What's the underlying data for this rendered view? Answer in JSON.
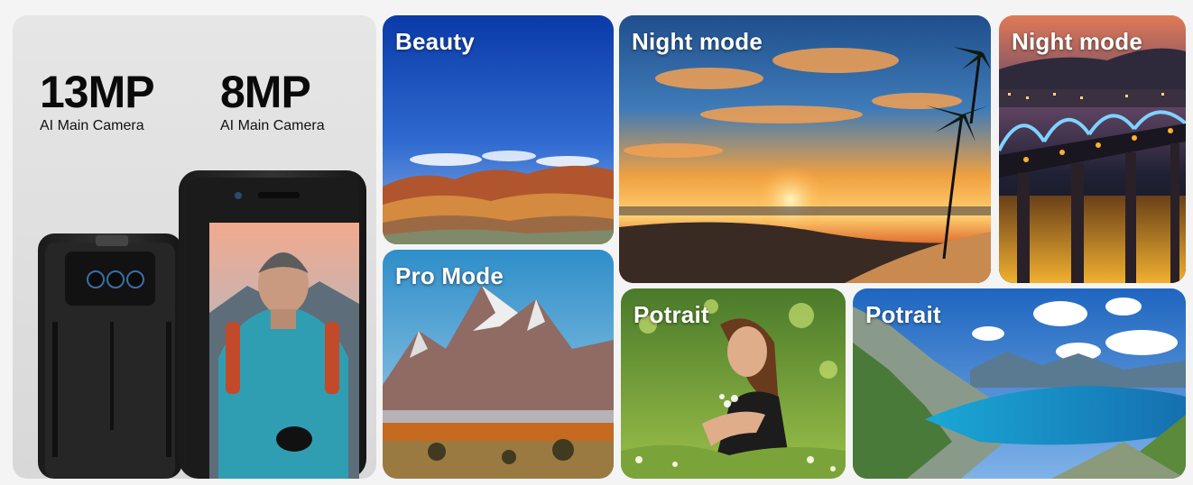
{
  "hero": {
    "specs": [
      {
        "value": "13MP",
        "caption": "AI Main Camera"
      },
      {
        "value": "8MP",
        "caption": "AI Main Camera"
      }
    ]
  },
  "tiles": [
    {
      "label": "Beauty"
    },
    {
      "label": "Night mode"
    },
    {
      "label": "Night mode"
    },
    {
      "label": "Pro Mode"
    },
    {
      "label": "Potrait"
    },
    {
      "label": "Potrait"
    }
  ]
}
